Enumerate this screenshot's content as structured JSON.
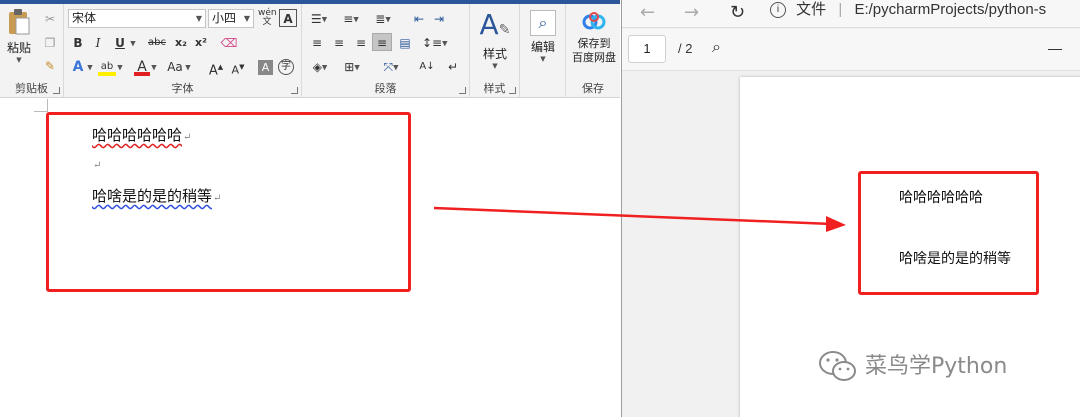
{
  "word": {
    "ribbon": {
      "clipboard": {
        "label": "剪贴板",
        "paste": "粘贴"
      },
      "font": {
        "label": "字体",
        "font_name": "宋体",
        "font_size": "小四",
        "bold": "B",
        "italic": "I",
        "underline": "U",
        "strike": "abc",
        "subscript": "x₂",
        "superscript": "x²",
        "change_case": "Aa",
        "grow": "A",
        "shrink": "A",
        "phonetic": "wén 文",
        "char_border": "A"
      },
      "paragraph": {
        "label": "段落"
      },
      "styles": {
        "label": "样式",
        "button": "样式"
      },
      "editing": {
        "button": "编辑"
      },
      "save": {
        "label": "保存",
        "button_line1": "保存到",
        "button_line2": "百度网盘"
      }
    },
    "document": {
      "lines": [
        "哈哈哈哈哈哈",
        "",
        "哈啥是的是的稍等"
      ]
    }
  },
  "browser": {
    "nav": {
      "file_label": "文件",
      "address": "E:/pycharmProjects/python-s"
    },
    "pdf": {
      "current_page": "1",
      "total_pages": "/ 2",
      "lines": [
        "哈哈哈哈哈哈",
        "哈啥是的是的稍等"
      ]
    }
  },
  "watermark": {
    "text": "菜鸟学Python"
  },
  "colors": {
    "annotation": "#f02020",
    "word_brand": "#2b579a",
    "spell_error": "#e02020"
  }
}
